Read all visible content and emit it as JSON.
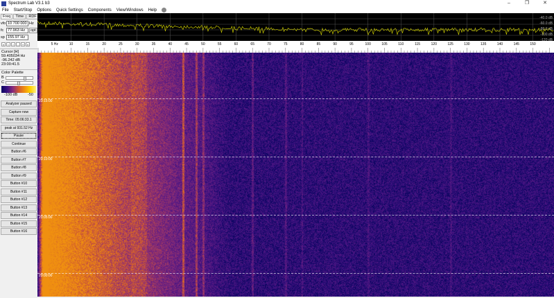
{
  "window": {
    "title": "Spectrum Lab V3.1 b3",
    "minimize": "–",
    "restore": "❐",
    "close": "✕"
  },
  "menu": [
    "File",
    "Start/Stop",
    "Options",
    "Quick Settings",
    "Components",
    "View/Windows",
    "Help"
  ],
  "tabs": [
    "Freq",
    "Time",
    "RDF"
  ],
  "freq": {
    "vfo_label": "vfo",
    "vfo": "10 700 000",
    "vfo_unit": "Hz",
    "fc_label": "fc",
    "fc": "77.963 Hz",
    "opt": "opt",
    "sp_label": "sp",
    "sp": "155.97 Hz"
  },
  "nav_arrows": [
    "«",
    "‹",
    "›",
    "-",
    "+",
    "»"
  ],
  "cursor": {
    "title": "Cursor [H]",
    "freq": "59.405034 Hz",
    "level": "-96.242 dB",
    "time": "23:00:41.5"
  },
  "color_palette": {
    "title": "Color Palette",
    "b_label": "B",
    "c_label": "C",
    "b_value": 0.7,
    "c_value": 0.45,
    "min": "-100 dB",
    "max": "-50"
  },
  "buttons": [
    "Analyzer paused",
    "Capture now",
    "Time:  05:06:33.1",
    "peak at 931.52 Hz",
    "Pause",
    "Continue",
    "Button #6",
    "Button #7",
    "Button #8",
    "Button #9",
    "Button #10",
    "Button #11",
    "Button #12",
    "Button #13",
    "Button #14",
    "Button #15",
    "Button #16"
  ],
  "spectrum": {
    "db_labels": [
      "-40.0 dB",
      "-60.0 dB",
      "-80.0 dB",
      "-100 dB",
      "-120 dB"
    ],
    "trace_color": "#c8c800"
  },
  "freq_axis": {
    "unit_label": "5 Hz",
    "ticks": [
      "5",
      "10",
      "15",
      "20",
      "25",
      "30",
      "35",
      "40",
      "45",
      "50",
      "55",
      "60",
      "65",
      "70",
      "75",
      "80",
      "85",
      "90",
      "95",
      "100",
      "105",
      "110",
      "115",
      "120",
      "125",
      "130",
      "135",
      "140",
      "145",
      "150"
    ]
  },
  "waterfall": {
    "time_labels": [
      "23:15:00",
      "23:10:00",
      "23:05:00",
      "23:00:00"
    ]
  }
}
